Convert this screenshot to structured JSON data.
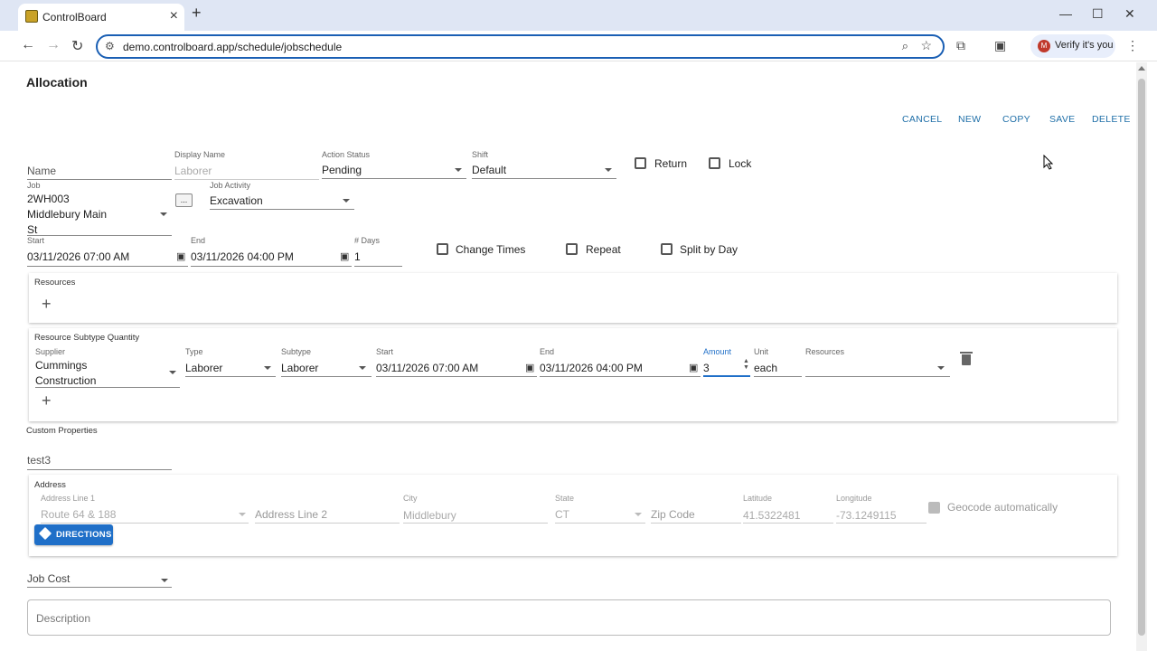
{
  "browser": {
    "tab_title": "ControlBoard",
    "url": "demo.controlboard.app/schedule/jobschedule",
    "profile_label": "Verify it's you",
    "profile_initial": "M"
  },
  "page": {
    "title": "Allocation",
    "actions": {
      "cancel": "CANCEL",
      "new": "NEW",
      "copy": "COPY",
      "save": "SAVE",
      "delete": "DELETE"
    }
  },
  "form": {
    "name_placeholder": "Name",
    "display_name_label": "Display Name",
    "display_name_value": "Laborer",
    "action_status_label": "Action Status",
    "action_status_value": "Pending",
    "shift_label": "Shift",
    "shift_value": "Default",
    "return_label": "Return",
    "lock_label": "Lock",
    "job_label": "Job",
    "job_value_line1": "2WH003",
    "job_value_line2": "Middlebury Main",
    "job_value_line3": "St",
    "job_browse_label": "...",
    "job_activity_label": "Job Activity",
    "job_activity_value": "Excavation",
    "start_label": "Start",
    "start_value": "03/11/2026 07:00 AM",
    "end_label": "End",
    "end_value": "03/11/2026 04:00 PM",
    "days_label": "# Days",
    "days_value": "1",
    "change_times_label": "Change Times",
    "repeat_label": "Repeat",
    "split_by_day_label": "Split by Day"
  },
  "resources": {
    "title": "Resources"
  },
  "subtype_quantity": {
    "title": "Resource Subtype Quantity",
    "supplier_label": "Supplier",
    "supplier_line1": "Cummings",
    "supplier_line2": "Construction",
    "type_label": "Type",
    "type_value": "Laborer",
    "subtype_label": "Subtype",
    "subtype_value": "Laborer",
    "start_label": "Start",
    "start_value": "03/11/2026 07:00 AM",
    "end_label": "End",
    "end_value": "03/11/2026 04:00 PM",
    "amount_label": "Amount",
    "amount_value": "3",
    "unit_label": "Unit",
    "unit_value": "each",
    "resources_label": "Resources"
  },
  "custom_properties": {
    "title": "Custom Properties",
    "value": "test3"
  },
  "address": {
    "title": "Address",
    "line1_label": "Address Line 1",
    "line1_value": "Route 64 & 188",
    "line2_placeholder": "Address Line 2",
    "city_label": "City",
    "city_value": "Middlebury",
    "state_label": "State",
    "state_value": "CT",
    "zip_placeholder": "Zip Code",
    "latitude_label": "Latitude",
    "latitude_value": "41.5322481",
    "longitude_label": "Longitude",
    "longitude_value": "-73.1249115",
    "geocode_label": "Geocode automatically",
    "directions_label": "DIRECTIONS"
  },
  "job_cost_label": "Job Cost",
  "description_placeholder": "Description",
  "colors": {
    "accent": "#1f6fa8",
    "button": "#1f6fc8",
    "url_focus": "#1a5fb4",
    "tabbar": "#dfe6f4"
  }
}
